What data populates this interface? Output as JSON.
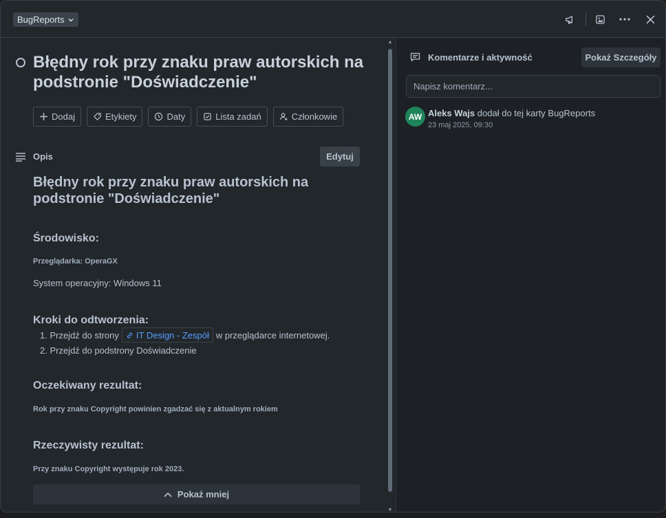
{
  "header": {
    "board_button": "BugReports",
    "icons": [
      "megaphone-icon",
      "image-icon",
      "more-icon",
      "close-icon"
    ]
  },
  "card": {
    "title": "Błędny rok przy znaku praw autorskich na podstronie \"Doświadczenie\"",
    "actions": [
      {
        "label": "Dodaj",
        "icon": "plus-icon"
      },
      {
        "label": "Etykiety",
        "icon": "tag-icon"
      },
      {
        "label": "Daty",
        "icon": "clock-icon"
      },
      {
        "label": "Lista zadań",
        "icon": "checklist-icon"
      },
      {
        "label": "Członkowie",
        "icon": "add-member-icon"
      }
    ]
  },
  "description": {
    "label": "Opis",
    "edit_label": "Edytuj",
    "heading": "Błędny rok przy znaku praw autorskich na podstronie \"Doświadczenie\"",
    "env_heading": "Środowisko:",
    "browser": "Przeglądarka: OperaGX",
    "os": "System operacyjny: Windows 11",
    "steps_heading": "Kroki do odtworzenia:",
    "step1_prefix": "1. Przejdź do strony",
    "step1_link": "IT Design - Zespół",
    "step1_suffix": "w przeglądarce internetowej.",
    "step2": "2. Przejdź do podstrony Doświadczenie",
    "expected_heading": "Oczekiwany rezultat:",
    "expected_text": "Rok przy znaku Copyright powinien zgadzać się z aktualnym rokiem",
    "actual_heading": "Rzeczywisty rezultat:",
    "actual_text": "Przy znaku Copyright występuje rok 2023.",
    "show_less_label": "Pokaż mniej"
  },
  "comments": {
    "title": "Komentarze i aktywność",
    "details_button": "Pokaż Szczegóły",
    "input_placeholder": "Napisz komentarz...",
    "activity": {
      "avatar_initials": "AW",
      "avatar_color": "#1f845a",
      "user": "Aleks Wajs",
      "text": "dodał do tej karty BugReports",
      "time": "23 maj 2025, 09:30"
    }
  }
}
